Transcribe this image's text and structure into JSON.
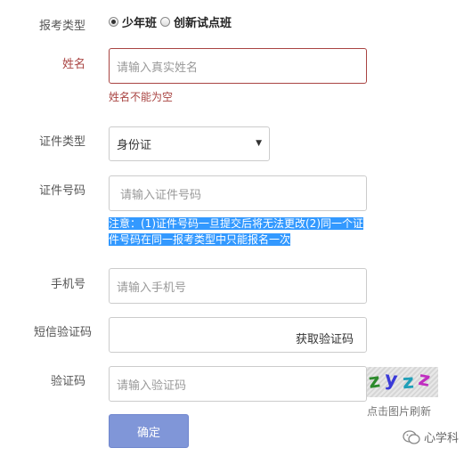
{
  "exam_type": {
    "label": "报考类型",
    "options": [
      {
        "label": "少年班",
        "checked": true
      },
      {
        "label": "创新试点班",
        "checked": false
      }
    ]
  },
  "name": {
    "label": "姓名",
    "placeholder": "请输入真实姓名",
    "error": "姓名不能为空"
  },
  "id_type": {
    "label": "证件类型",
    "selected": "身份证"
  },
  "id_number": {
    "label": "证件号码",
    "placeholder": "请输入证件号码",
    "note_line1": "注意：(1)证件号码一旦提交后将无法更改(2)同一个证",
    "note_line2": "件号码在同一报考类型中只能报名一次"
  },
  "phone": {
    "label": "手机号",
    "placeholder": "请输入手机号"
  },
  "sms_code": {
    "label": "短信验证码",
    "button": "获取验证码"
  },
  "captcha": {
    "label": "验证码",
    "placeholder": "请输入验证码",
    "image_text": "zyzz",
    "refresh": "点击图片刷新"
  },
  "submit": {
    "label": "确定"
  },
  "watermark": {
    "text": "心学科",
    "icon": "wechat-icon"
  },
  "colors": {
    "error": "#a94442",
    "submit_bg": "#8096d8",
    "highlight": "#3399ff"
  }
}
